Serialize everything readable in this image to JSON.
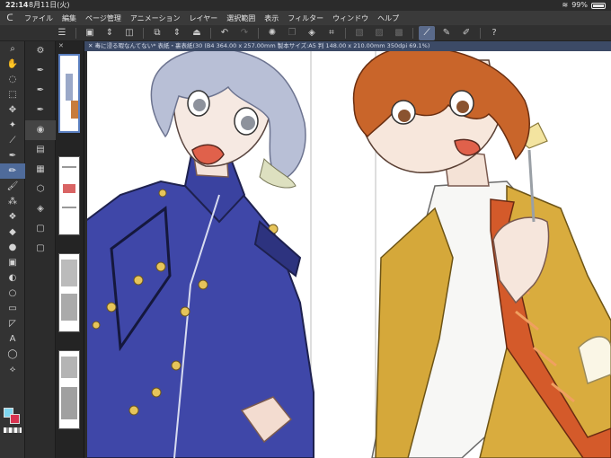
{
  "status_bar": {
    "time": "22:14",
    "date": "8月11日(火)",
    "battery_text": "99%",
    "battery_level": 0.99
  },
  "menu": {
    "items": [
      "ファイル",
      "編集",
      "ページ管理",
      "アニメーション",
      "レイヤー",
      "選択範囲",
      "表示",
      "フィルター",
      "ウィンドウ",
      "ヘルプ"
    ]
  },
  "command_bar": {
    "icons": [
      "menu-icon",
      "new-icon",
      "arrow-up-down-icon",
      "save-icon",
      "open-icon",
      "arrow-up-down-icon",
      "export-icon",
      "undo-icon",
      "redo-icon",
      "select-loading-icon",
      "copy-icon",
      "fill-icon",
      "transform-icon",
      "clear-icon",
      "invert-icon",
      "deselect-icon",
      "active-brush-icon",
      "brush-alt-icon",
      "pen-icon",
      "help-icon"
    ]
  },
  "tools": [
    "zoom-icon",
    "hand-icon",
    "lasso-icon",
    "select-icon",
    "move-icon",
    "magic-wand-icon",
    "eyedropper-icon",
    "pen-tool-icon",
    "pencil-icon",
    "brush-icon",
    "airbrush-icon",
    "decoration-icon",
    "eraser-icon",
    "blend-icon",
    "fill-icon",
    "gradient-icon",
    "figure-icon",
    "frame-icon",
    "ruler-icon",
    "text-icon",
    "balloon-icon",
    "correction-icon"
  ],
  "subtools": [
    "settings-icon",
    "pen-a-icon",
    "pen-b-icon",
    "pen-c-icon",
    "layer-a-icon",
    "layer-b-icon",
    "layer-c-icon",
    "layer-d-icon",
    "stack-icon",
    "page-a-icon",
    "page-b-icon"
  ],
  "document_tab": {
    "title": "毒に浸る暇なんてない* 表紙・裏表紙(30 (B4 364.00 x 257.00mm 製本サイズ:A5 判 148.00 x 210.00mm 350dpi 69.1%)"
  },
  "colors": {
    "main_color": "#7fd6f0",
    "sub_color": "#d8324f",
    "accent": "#4f6b9a"
  }
}
